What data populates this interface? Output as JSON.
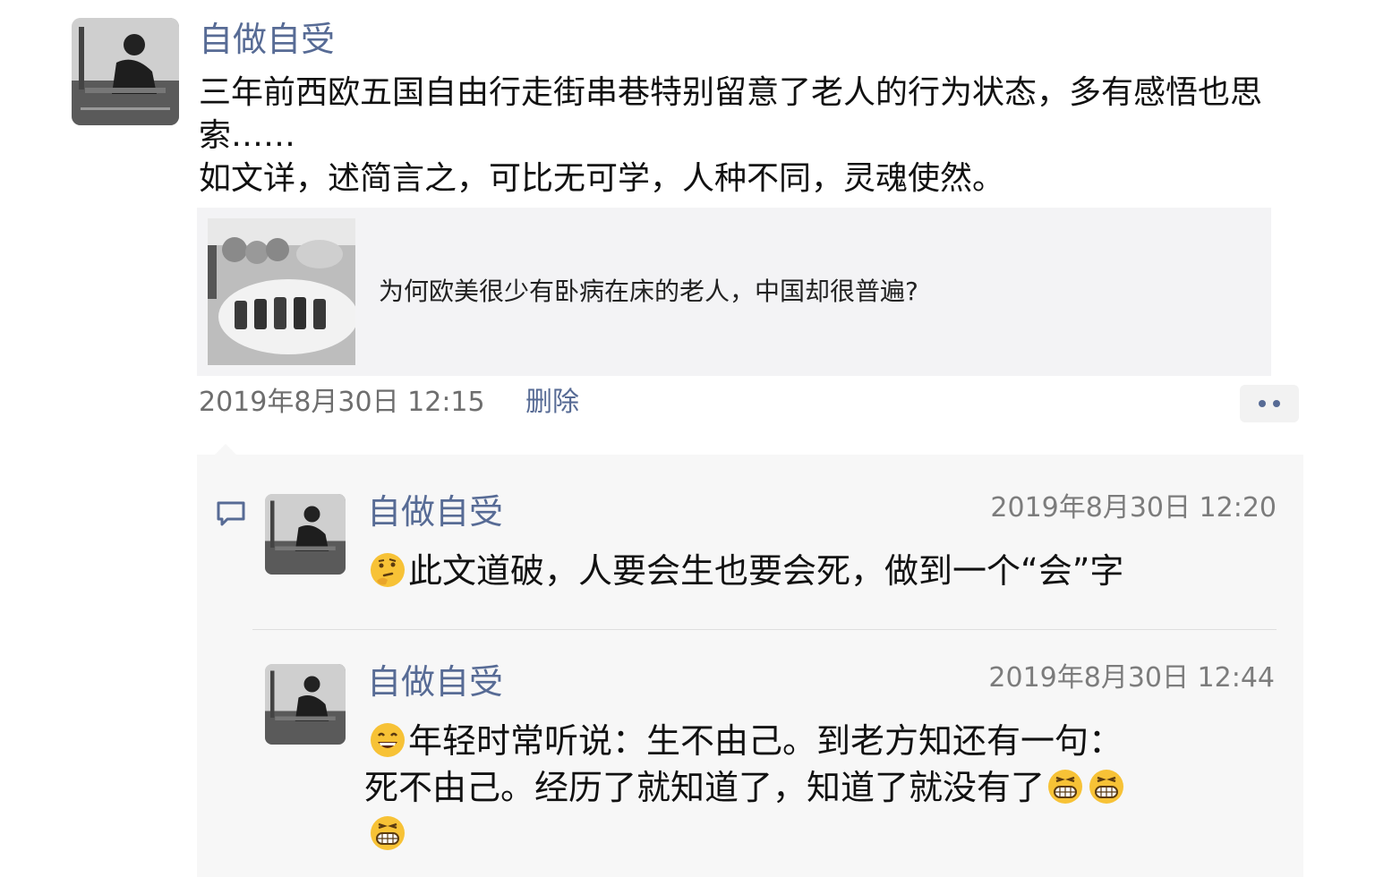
{
  "post": {
    "author": "自做自受",
    "text_lines": [
      "三年前西欧五国自由行走街串巷特别留意了老人的行为状态，多有感悟也思索……",
      "如文详，述简言之，可比无可学，人种不同，灵魂使然。"
    ],
    "link_card": {
      "title": "为何欧美很少有卧病在床的老人，中国却很普遍?"
    },
    "timestamp": "2019年8月30日 12:15",
    "delete_label": "删除",
    "more_icon": "more-dots-icon"
  },
  "comments": [
    {
      "author": "自做自受",
      "time": "2019年8月30日 12:20",
      "emoji": "thinking-face",
      "text": "此文道破，人要会生也要会死，做到一个“会”字"
    },
    {
      "author": "自做自受",
      "time": "2019年8月30日 12:44",
      "emoji": "grinning-face",
      "text_line1": "年轻时常听说：生不由己。到老方知还有一句：",
      "text_line2": "死不由己。经历了就知道了，知道了就没有了",
      "trailing_emoji": "beaming-face"
    }
  ],
  "colors": {
    "link_blue": "#576b95",
    "meta_gray": "#6e6e6e",
    "comment_bg": "#f7f7f7",
    "card_bg": "#f3f3f5"
  }
}
